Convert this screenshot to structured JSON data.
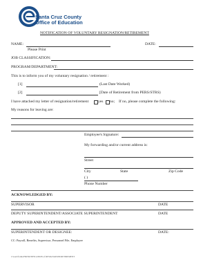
{
  "logo": {
    "line1": "Santa Cruz County",
    "line2": "Office of Education",
    "brand_color": "#1c4f8a"
  },
  "title": "NOTIFICATION OF VOLUNTARY RESIGNATION/RETIREMENT",
  "fields": {
    "name_label": "NAME:",
    "please_print": "Please Print",
    "date_label": "DATE:",
    "job_label": "JOB CLASSIFICATION:",
    "program_label": "PROGRAM/DEPARTMENT:"
  },
  "body": {
    "intro": "This is to inform you of my voluntary resignation / retirement :",
    "item1_num": "[1]",
    "item1_label": "(Last Date Worked)",
    "item2_num": "[2]",
    "item2_label": "[Date of Retirement from PERS/STRS)",
    "attached_text": "I have attached my letter of resignation/retirement",
    "yes": "yes",
    "no": "no;",
    "if_no": "If no, please complete the following:",
    "reasons_label": "My reasons for leaving are:"
  },
  "employee": {
    "signature_label": "Employee's Signature:",
    "forwarding_label": "My forwarding and/or current address is:",
    "street_label": "Street",
    "city_label": "City",
    "state_label": "State",
    "zip_label": "Zip Code",
    "phone_parens": "(          )",
    "phone_label": "Phone Number"
  },
  "acknowledged": {
    "heading": "ACKNOWLEDGED BY:",
    "supervisor": "SUPERVISOR",
    "deputy": "DEPUTY SUPERINTENDENT/ASSOCIATE SUPERINTENDENT",
    "date_label": "DATE"
  },
  "approved": {
    "heading": "APPROVED AND ACCEPTED BY:",
    "superintendent": "SUPERINTENDENT OR DESIGNEE:",
    "date_label": "DATE:"
  },
  "cc_line": "CC:   Payroll, Benefits, Supervisor, Personnel File, Employee",
  "footer": "l:/word/forms/HR/NOTIFICATION of RESIGNATION/RETIREMENT"
}
